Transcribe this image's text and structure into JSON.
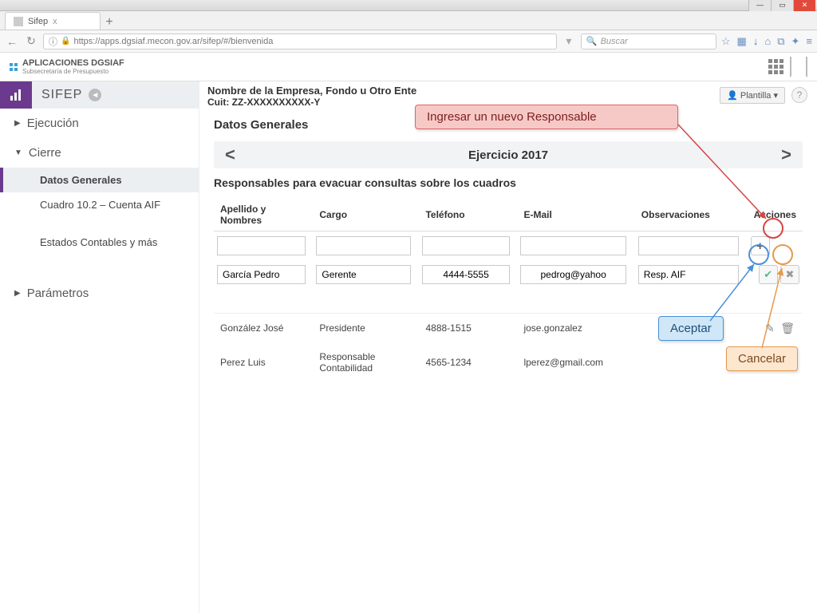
{
  "browser": {
    "tab_title": "Sifep",
    "new_tab": "+",
    "close_tab": "x",
    "url": "https://apps.dgsiaf.mecon.gov.ar/sifep/#/bienvenida",
    "search_placeholder": "Buscar"
  },
  "app": {
    "brand_line1": "APLICACIONES DGSIAF",
    "brand_line2": "Subsecretaría de Presupuesto",
    "module": "SIFEP",
    "company": "Nombre de la Empresa, Fondo u Otro Ente",
    "cuit": "Cuit: ZZ-XXXXXXXXXX-Y",
    "plantilla": "Plantilla",
    "help": "?"
  },
  "sidebar": {
    "ejecucion": "Ejecución",
    "cierre": "Cierre",
    "parametros": "Parámetros",
    "items": {
      "datos_generales": "Datos Generales",
      "cuadro102": "Cuadro 10.2  – Cuenta AIF",
      "estados": "Estados Contables y más"
    }
  },
  "content": {
    "heading": "Datos Generales",
    "period_label": "Ejercicio 2017",
    "prev": "<",
    "next": ">",
    "subheading": "Responsables para evacuar consultas sobre los cuadros",
    "columns": {
      "nombre": "Apellido y Nombres",
      "cargo": "Cargo",
      "telefono": "Teléfono",
      "email": "E-Mail",
      "obs": "Observaciones",
      "acciones": "Acciones"
    },
    "add": "+",
    "edit_row": {
      "nombre": "García Pedro",
      "cargo": "Gerente",
      "telefono": "4444-5555",
      "email": "pedrog@yahoo",
      "obs": "Resp. AIF"
    },
    "rows": [
      {
        "nombre": "González José",
        "cargo": "Presidente",
        "telefono": "4888-1515",
        "email": "jose.gonzalez",
        "obs": ""
      },
      {
        "nombre": "Perez Luis",
        "cargo": "Responsable Contabilidad",
        "telefono": "4565-1234",
        "email": "lperez@gmail.com",
        "obs": ""
      }
    ]
  },
  "annotations": {
    "nuevo": "Ingresar un nuevo Responsable",
    "aceptar": "Aceptar",
    "cancelar": "Cancelar"
  },
  "icons": {
    "check": "✔",
    "cross": "✖",
    "pencil": "✎",
    "trash": "🗑",
    "lock": "🔒",
    "search": "🔍",
    "star": "☆",
    "home": "⌂",
    "down": "↓",
    "user": "👤",
    "menu": "≡",
    "grid_alt": "▦"
  }
}
